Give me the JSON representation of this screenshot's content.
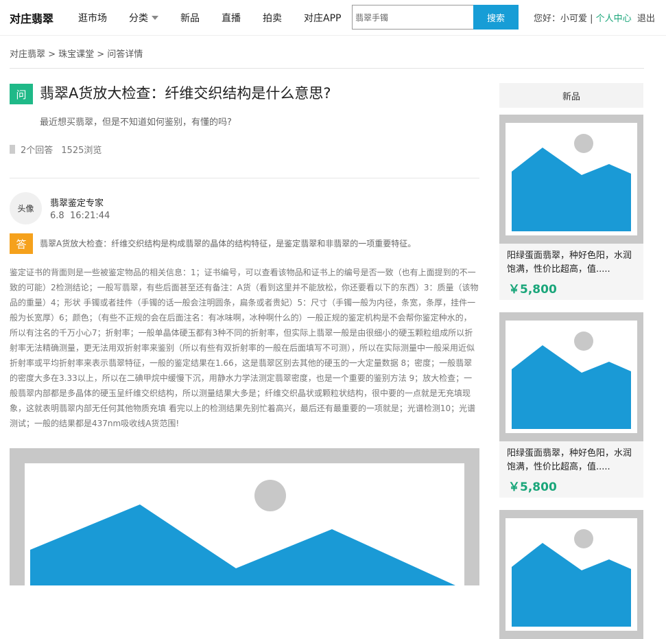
{
  "header": {
    "logo": "对庄翡翠",
    "nav": [
      {
        "label": "逛市场"
      },
      {
        "label": "分类"
      },
      {
        "label": "新品"
      },
      {
        "label": "直播"
      },
      {
        "label": "拍卖"
      },
      {
        "label": "对庄APP"
      }
    ],
    "search": {
      "value": "翡翠手镯",
      "button": "搜索"
    },
    "user": {
      "greeting": "您好：小可爱 | ",
      "center": "个人中心",
      "logout": "退出"
    }
  },
  "breadcrumb": "对庄翡翠 > 珠宝课堂 > 问答详情",
  "question": {
    "badge": "问",
    "title": "翡翠A货放大检查：纤维交织结构是什么意思?",
    "desc": "最近想买翡翠，但是不知道如何鉴别，有懂的吗?",
    "answers": "2个回答",
    "views": "1525浏览"
  },
  "answer": {
    "avatar": "头像",
    "expert": "翡翠鉴定专家",
    "time": "6.8  16:21:44",
    "badge": "答",
    "summary": "翡翠A货放大检查：纤维交织结构是构成翡翠的晶体的结构特征，是鉴定翡翠和非翡翠的一项重要特征。",
    "body": "鉴定证书的背面则是一些被鉴定物品的相关信息：1；证书编号，可以查看该物品和证书上的编号是否一致（也有上面提到的不一致的可能）2检测结论；一般写翡翠，有些后面甚至还有备注：A货（看到这里并不能放松，你还要看以下的东西）3：质量（该物品的重量）4；形状 手镯或者挂件（手镯的话一般会注明圆条，扁条或者贵妃）5：尺寸（手镯一般为内径，条宽，条厚，挂件一般为长宽厚）6；颜色；（有些不正规的会在后面注名：有冰味啊，冰种啊什么的）一般正规的鉴定机构是不会帮你鉴定种水的，所以有注名的千万小心7；折射率；一般单晶体硬玉都有3种不同的折射率，但实际上翡翠一般是由很细小的硬玉颗粒组成所以折射率无法精确测量，更无法用双折射率来鉴别（所以有些有双折射率的一般在后面填写不可测），所以在实际测量中一般采用近似折射率或平均折射率来表示翡翠特征，一般的鉴定结果在1.66，这是翡翠区别去其他的硬玉的一大定量数据 8；密度；一般翡翠的密度大多在3.33以上，所以在二碘甲烷中缓慢下沉，用静水力学法测定翡翠密度，也是一个重要的鉴别方法 9；放大检查；一般翡翠内部都是多晶体的硬玉呈纤维交织结构，所以测量结果大多是；纤维交织晶状或颗粒状结构，很中要的一点就是无充填现象，这就表明翡翠内部无任何其他物质充填 看完以上的检测结果先别忙着高兴，最后还有最重要的一项就是；光谱检测10；光谱测试；一般的结果都是437nm吸收线A货范围!"
  },
  "sidebar": {
    "title": "新品",
    "products": [
      {
        "name": "阳绿蛋面翡翠，种好色阳，水润饱满，性价比超高，值.....",
        "price": "￥5,800"
      },
      {
        "name": "阳绿蛋面翡翠，种好色阳，水润饱满，性价比超高，值.....",
        "price": "￥5,800"
      }
    ]
  },
  "colors": {
    "accent": "#179dd6",
    "green": "#1fb988",
    "orange": "#f5a11c",
    "price": "#1aa67a"
  }
}
